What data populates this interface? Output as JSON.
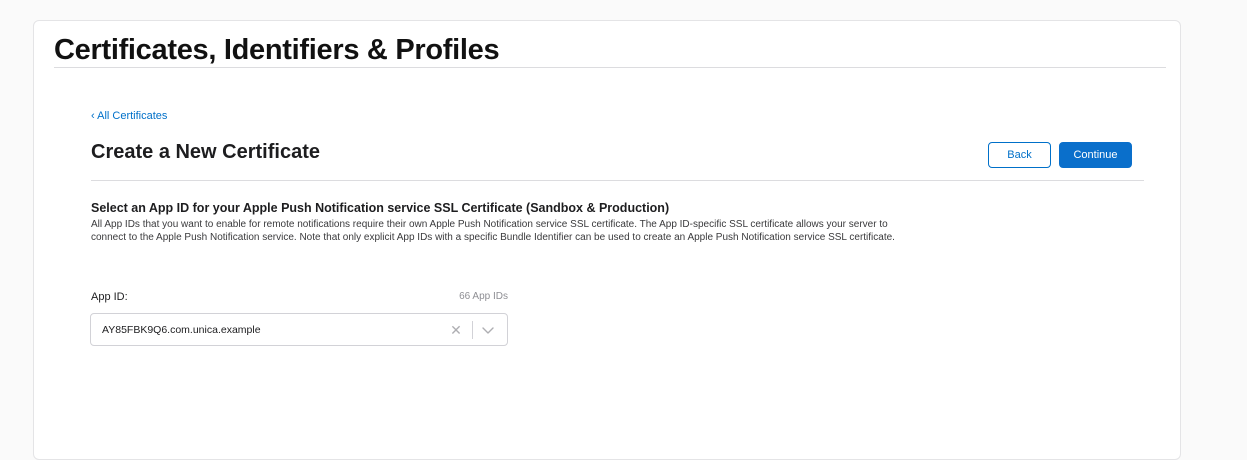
{
  "header": {
    "title": "Certificates, Identifiers & Profiles"
  },
  "breadcrumb": {
    "label": "‹ All Certificates"
  },
  "section": {
    "title": "Create a New Certificate",
    "back_label": "Back",
    "continue_label": "Continue"
  },
  "form": {
    "heading": "Select an App ID for your Apple Push Notification service SSL Certificate (Sandbox & Production)",
    "description": "All App IDs that you want to enable for remote notifications require their own Apple Push Notification service SSL certificate. The App ID-specific SSL certificate allows your server to connect to the Apple Push Notification service. Note that only explicit App IDs with a specific Bundle Identifier can be used to create an Apple Push Notification service SSL certificate.",
    "app_id_label": "App ID:",
    "app_id_count": "66 App IDs",
    "app_id_value": "AY85FBK9Q6.com.unica.example"
  },
  "icons": {
    "clear": "close-icon",
    "dropdown": "chevron-down-icon"
  },
  "colors": {
    "accent": "#0a6fcb",
    "link": "#0070c9"
  }
}
